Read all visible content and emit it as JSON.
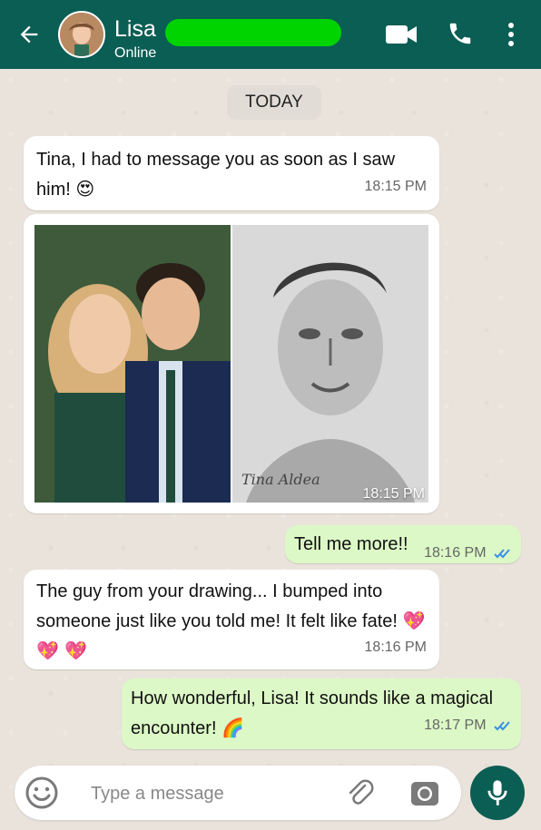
{
  "header": {
    "contact_name": "Lisa",
    "status": "Online",
    "bg_color": "#0b5e54",
    "redaction_color": "#00d400"
  },
  "chat": {
    "date_label": "TODAY",
    "messages": [
      {
        "direction": "incoming",
        "text": "Tina, I had to message you as soon as I saw him!",
        "emoji": "😍",
        "time": "18:15 PM"
      },
      {
        "direction": "incoming",
        "type": "image",
        "signature": "Tina Aldea",
        "time": "18:15 PM"
      },
      {
        "direction": "outgoing",
        "text": "Tell me more!!",
        "time": "18:16 PM",
        "read": true
      },
      {
        "direction": "incoming",
        "text": "The guy from your drawing... I bumped into someone just like you told me! It felt like fate!",
        "emoji": "💖 💖 💖",
        "time": "18:16 PM"
      },
      {
        "direction": "outgoing",
        "text": "How wonderful, Lisa! It sounds like a magical encounter!",
        "emoji": "🌈",
        "time": "18:17 PM",
        "read": true
      }
    ]
  },
  "composer": {
    "placeholder": "Type a message"
  },
  "icons": {
    "back": "arrow-left-icon",
    "video": "video-call-icon",
    "call": "phone-icon",
    "menu": "kebab-menu-icon",
    "emoji": "emoji-icon",
    "attach": "paperclip-icon",
    "camera": "camera-icon",
    "mic": "microphone-icon",
    "read_ticks": "double-check-icon"
  }
}
